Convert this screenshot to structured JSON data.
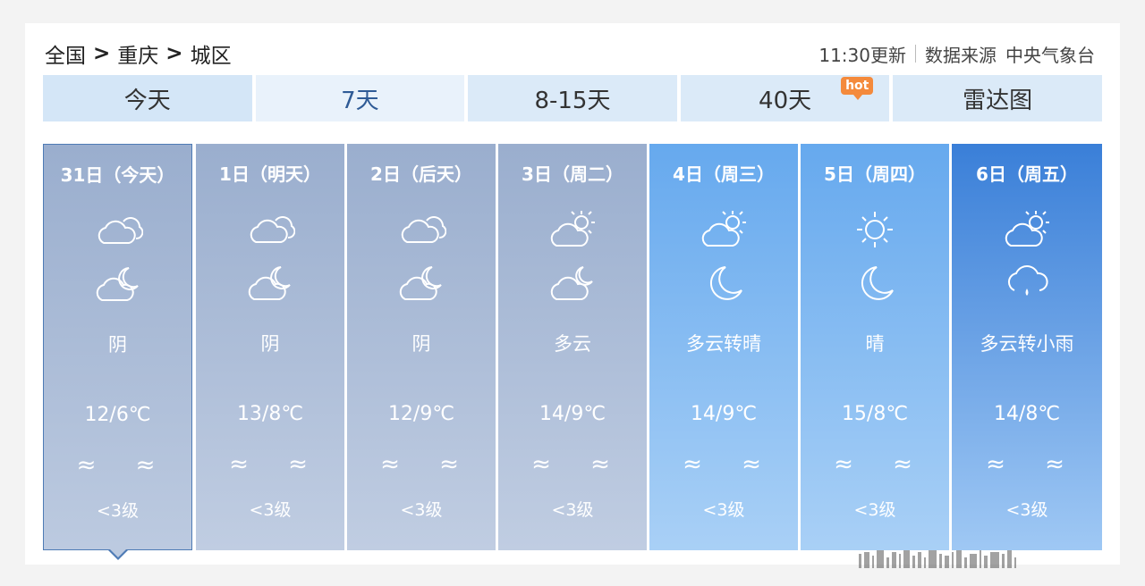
{
  "breadcrumb": {
    "items": [
      "全国",
      "重庆",
      "城区"
    ],
    "separator": ">"
  },
  "update": {
    "time_text": "11:30更新",
    "source_label": "数据来源",
    "source_name": "中央气象台"
  },
  "tabs": [
    {
      "label": "今天"
    },
    {
      "label": "7天",
      "active": true
    },
    {
      "label": "8-15天"
    },
    {
      "label": "40天",
      "badge": "hot"
    },
    {
      "label": "雷达图"
    }
  ],
  "days": [
    {
      "date": "31日（今天）",
      "day_icon": "cloudy-icon",
      "night_icon": "cloudy-night-icon",
      "weather": "阴",
      "temp": "12/6℃",
      "wind_icons": "≈ ≈",
      "wind_level": "<3级",
      "selected": true
    },
    {
      "date": "1日（明天）",
      "day_icon": "cloudy-icon",
      "night_icon": "cloudy-night-icon",
      "weather": "阴",
      "temp": "13/8℃",
      "wind_icons": "≈ ≈",
      "wind_level": "<3级"
    },
    {
      "date": "2日（后天）",
      "day_icon": "cloudy-icon",
      "night_icon": "cloudy-night-icon",
      "weather": "阴",
      "temp": "12/9℃",
      "wind_icons": "≈ ≈",
      "wind_level": "<3级"
    },
    {
      "date": "3日（周二）",
      "day_icon": "partly-cloudy-icon",
      "night_icon": "partly-cloudy-night-icon",
      "weather": "多云",
      "temp": "14/9℃",
      "wind_icons": "≈ ≈",
      "wind_level": "<3级"
    },
    {
      "date": "4日（周三）",
      "day_icon": "partly-cloudy-icon",
      "night_icon": "moon-icon",
      "weather": "多云转晴",
      "temp": "14/9℃",
      "wind_icons": "≈ ≈",
      "wind_level": "<3级"
    },
    {
      "date": "5日（周四）",
      "day_icon": "sun-icon",
      "night_icon": "moon-icon",
      "weather": "晴",
      "temp": "15/8℃",
      "wind_icons": "≈ ≈",
      "wind_level": "<3级"
    },
    {
      "date": "6日（周五）",
      "day_icon": "partly-cloudy-icon",
      "night_icon": "light-rain-icon",
      "weather": "多云转小雨",
      "temp": "14/8℃",
      "wind_icons": "≈ ≈",
      "wind_level": "<3级"
    }
  ],
  "colors": {
    "accent": "#2f5b96",
    "tab_bg": "#dbeaf8",
    "hot_badge": "#f48a3c",
    "past_card": "#9aaece",
    "future_card": "#66a9ee",
    "last_card": "#3a7fd8"
  }
}
